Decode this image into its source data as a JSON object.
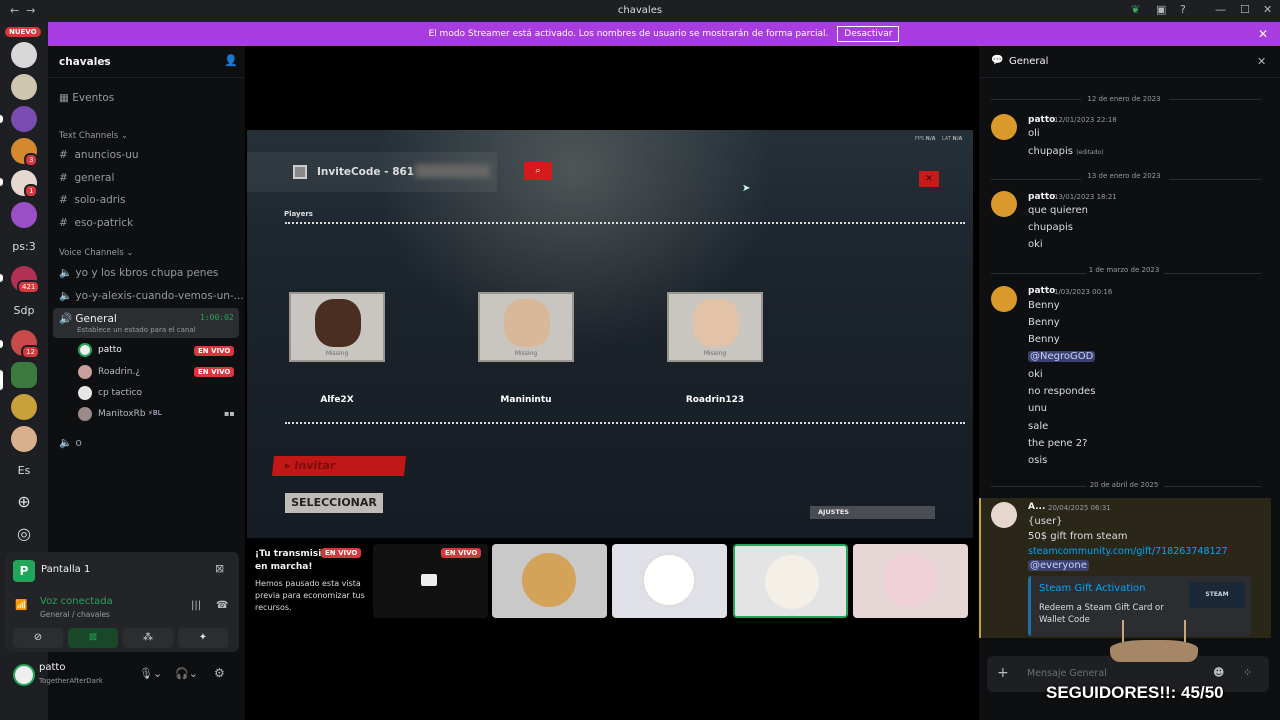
{
  "window": {
    "title": "chavales"
  },
  "banner": {
    "text": "El modo Streamer está activado. Los nombres de usuario se mostrarán de forma parcial.",
    "button": "Desactivar"
  },
  "rail": {
    "new_badge": "NUEVO",
    "servers": [
      {
        "label": "",
        "badge": "",
        "color": "#d8d8d8"
      },
      {
        "label": "",
        "badge": "",
        "color": "#cfc6b0"
      },
      {
        "label": "",
        "badge": "",
        "color": "#7a4bb0"
      },
      {
        "label": "",
        "badge": "3",
        "color": "#d4892e"
      },
      {
        "label": "",
        "badge": "1",
        "color": "#e4d8d0"
      },
      {
        "label": "",
        "badge": "",
        "color": "#9b4fc7"
      },
      {
        "label": "ps:3",
        "badge": ""
      },
      {
        "label": "",
        "badge": "421",
        "color": "#b03056"
      },
      {
        "label": "Sdp",
        "badge": ""
      },
      {
        "label": "",
        "badge": "12",
        "color": "#c94a4a"
      },
      {
        "label": "",
        "badge": "",
        "color": "#3a7a3e"
      },
      {
        "label": "",
        "badge": "",
        "color": "#c9a13a"
      },
      {
        "label": "",
        "badge": "",
        "color": "#d9b08c"
      },
      {
        "label": "Es",
        "badge": ""
      }
    ]
  },
  "sidebar": {
    "server_name": "chavales",
    "events": "Eventos",
    "text_category": "Text Channels",
    "text_channels": [
      "anuncios-uu",
      "general",
      "solo-adris",
      "eso-patrick"
    ],
    "voice_category": "Voice Channels",
    "voice_channels": [
      "yo y los kbros chupa penes",
      "yo-y-alexis-cuando-vemos-un-..."
    ],
    "active_voice": {
      "name": "General",
      "timer": "1:00:02",
      "status": "Establece un estado para el canal"
    },
    "voice_users": [
      {
        "name": "patto",
        "live": "EN VIVO"
      },
      {
        "name": "Roadrin.¿",
        "live": "EN VIVO"
      },
      {
        "name": "cp tactico",
        "live": ""
      },
      {
        "name": "ManitoxRb",
        "live": "",
        "tag": "BL"
      }
    ],
    "extra_channel": "o"
  },
  "voice_panel": {
    "screen": "Pantalla 1",
    "connected": "Voz conectada",
    "location": "General / chavales"
  },
  "user_panel": {
    "name": "patto",
    "status": "TogetherAfterDark"
  },
  "game": {
    "invite_code": "InviteCode - 861",
    "fps_label": "FPS",
    "fps_value": "N/A",
    "lat_label": "LAT",
    "lat_value": "N/A",
    "players_label": "Players",
    "players": [
      {
        "name": "Alfe2X",
        "status": "Missing"
      },
      {
        "name": "Maninintu",
        "status": "Missing"
      },
      {
        "name": "Roadrin123",
        "status": "Missing"
      }
    ],
    "invite_button": "Invitar",
    "select_button": "SELECCIONAR",
    "settings_button": "AJUSTES"
  },
  "stream_notice": {
    "title": "¡Tu transmisión está en marcha!",
    "body": "Hemos pausado esta vista previa para economizar tus recursos.",
    "live": "EN VIVO",
    "live2": "EN VIVO"
  },
  "chat": {
    "channel": "General",
    "groups": [
      {
        "date": "12 de enero de 2023",
        "user": "patto",
        "time": "12/01/2023 22:18",
        "lines": [
          "oli",
          "chupapis"
        ],
        "edited": "(editado)"
      },
      {
        "date": "13 de enero de 2023",
        "user": "patto",
        "time": "13/01/2023 18:21",
        "lines": [
          "que quieren",
          "chupapis",
          "oki"
        ]
      },
      {
        "date": "1 de marzo de 2023",
        "user": "patto",
        "time": "1/03/2023 00:16",
        "lines": [
          "Benny",
          "Benny",
          "Benny",
          "@NegroGOD",
          "oki",
          "no respondes",
          "unu",
          "sale",
          "the pene 2?",
          "osis"
        ]
      },
      {
        "date": "20 de abril de 2025",
        "user": "A...",
        "time": "20/04/2025 06:31",
        "lines": [
          "{user}",
          "50$ gift from steam",
          "steamcommunity.com/gift/718263748127",
          "@everyone"
        ]
      }
    ],
    "embed": {
      "title": "Steam Gift Activation",
      "desc": "Redeem a Steam Gift Card or Wallet Code",
      "logo": "STEAM"
    },
    "input_placeholder": "Mensaje General"
  },
  "overlay": {
    "followers": "SEGUIDORES!!: 45/50"
  }
}
